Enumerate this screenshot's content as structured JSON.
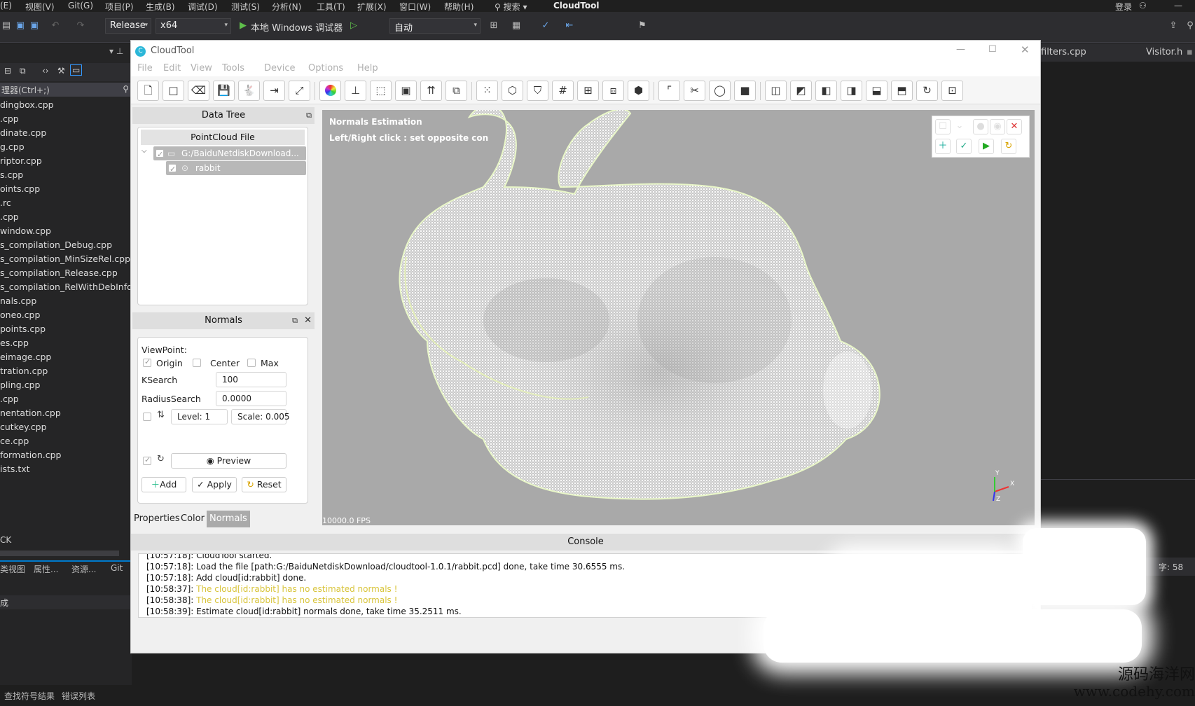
{
  "vs": {
    "menu": [
      "(E)",
      "视图(V)",
      "Git(G)",
      "项目(P)",
      "生成(B)",
      "调试(D)",
      "测试(S)",
      "分析(N)",
      "工具(T)",
      "扩展(X)",
      "窗口(W)",
      "帮助(H)"
    ],
    "search_label": "搜索",
    "solution_name": "CloudTool",
    "login": "登录",
    "config": "Release",
    "platform": "x64",
    "run_label": "本地 Windows 调试器",
    "auto": "自动",
    "solution_search": "理器(Ctrl+;)",
    "files": [
      "dingbox.cpp",
      ".cpp",
      "dinate.cpp",
      "g.cpp",
      "riptor.cpp",
      "s.cpp",
      "oints.cpp",
      ".rc",
      ".cpp",
      "window.cpp",
      "s_compilation_Debug.cpp",
      "s_compilation_MinSizeRel.cpp",
      "s_compilation_Release.cpp",
      "s_compilation_RelWithDebInfo.cp",
      "nals.cpp",
      "oneo.cpp",
      "points.cpp",
      "es.cpp",
      "eimage.cpp",
      "tration.cpp",
      "pling.cpp",
      ".cpp",
      "nentation.cpp",
      "cutkey.cpp",
      "ce.cpp",
      "formation.cpp",
      "ists.txt"
    ],
    "left_partial": "CK",
    "left_tabs": [
      "类视图",
      "属性...",
      "资源...",
      "Git"
    ],
    "left_bottom_label": "成",
    "right_tabs": [
      "filters.cpp",
      "Visitor.h"
    ],
    "right_status": "字: 58",
    "status_items": [
      "查找符号结果",
      "错误列表"
    ],
    "watermark_line1": "源码海洋网",
    "watermark_line2": "www.codehy.com"
  },
  "app": {
    "title": "CloudTool",
    "menu": [
      "File",
      "Edit",
      "View",
      "Tools",
      "Device",
      "Options",
      "Help"
    ],
    "toolbar_icons": [
      "new-file-icon",
      "new-icon",
      "clean-icon",
      "save-icon",
      "bunny-icon",
      "merge-icon",
      "transform-icon",
      "color-wheel-icon",
      "axes-icon",
      "boundingbox-icon",
      "cube-frame-icon",
      "normals-icon",
      "clone-icon",
      "select-points-icon",
      "cube-icon",
      "filter-icon",
      "grid-icon",
      "cluster-icon",
      "multi-select-icon",
      "solid-cube-icon",
      "corner-icon",
      "cut-icon",
      "circle-icon",
      "background-icon",
      "front-view-icon",
      "back-view-icon",
      "left-view-icon",
      "right-view-icon",
      "top-view-icon",
      "bottom-view-icon",
      "reset-view-icon",
      "screenshot-icon"
    ],
    "data_tree": {
      "title": "Data Tree",
      "header": "PointCloud File",
      "file": "G:/BaiduNetdiskDownload...",
      "cloud": "rabbit"
    },
    "normals": {
      "title": "Normals",
      "viewpoint_label": "ViewPoint:",
      "origin": "Origin",
      "center": "Center",
      "max": "Max",
      "ksearch_label": "KSearch",
      "ksearch_value": "100",
      "radius_label": "RadiusSearch",
      "radius_value": "0.0000",
      "level": "Level: 1",
      "scale": "Scale: 0.005",
      "preview": "Preview",
      "add": "Add",
      "apply": "Apply",
      "reset": "Reset"
    },
    "bottom_tabs": [
      "Properties",
      "Color",
      "Normals"
    ],
    "viewport": {
      "title": "Normals Estimation",
      "hint": "Left/Right click : set opposite con",
      "fps": "10000.0 FPS",
      "axis_x": "X",
      "axis_y": "Y",
      "axis_z": "Z"
    },
    "console": {
      "title": "Console",
      "logs": [
        {
          "text": "[10:57:18]: CloudTool started.",
          "level": "info"
        },
        {
          "text": "[10:57:18]: Load the file [path:G:/BaiduNetdiskDownload/cloudtool-1.0.1/rabbit.pcd] done, take time 30.6555 ms.",
          "level": "info"
        },
        {
          "text": "[10:57:18]: Add cloud[id:rabbit] done.",
          "level": "info"
        },
        {
          "text": "The cloud[id:rabbit] has no estimated normals !",
          "prefix": "[10:58:37]: ",
          "level": "warning"
        },
        {
          "text": "The cloud[id:rabbit] has no estimated normals !",
          "prefix": "[10:58:38]: ",
          "level": "warning"
        },
        {
          "text": "[10:58:39]: Estimate cloud[id:rabbit] normals done, take time 35.2511 ms.",
          "level": "info"
        }
      ]
    },
    "colors": {
      "warning": "#d8c43a",
      "viewport_bg": "#a9a9a9",
      "active_tab": "#aaaaaa",
      "vs_accent": "#007acc"
    }
  }
}
